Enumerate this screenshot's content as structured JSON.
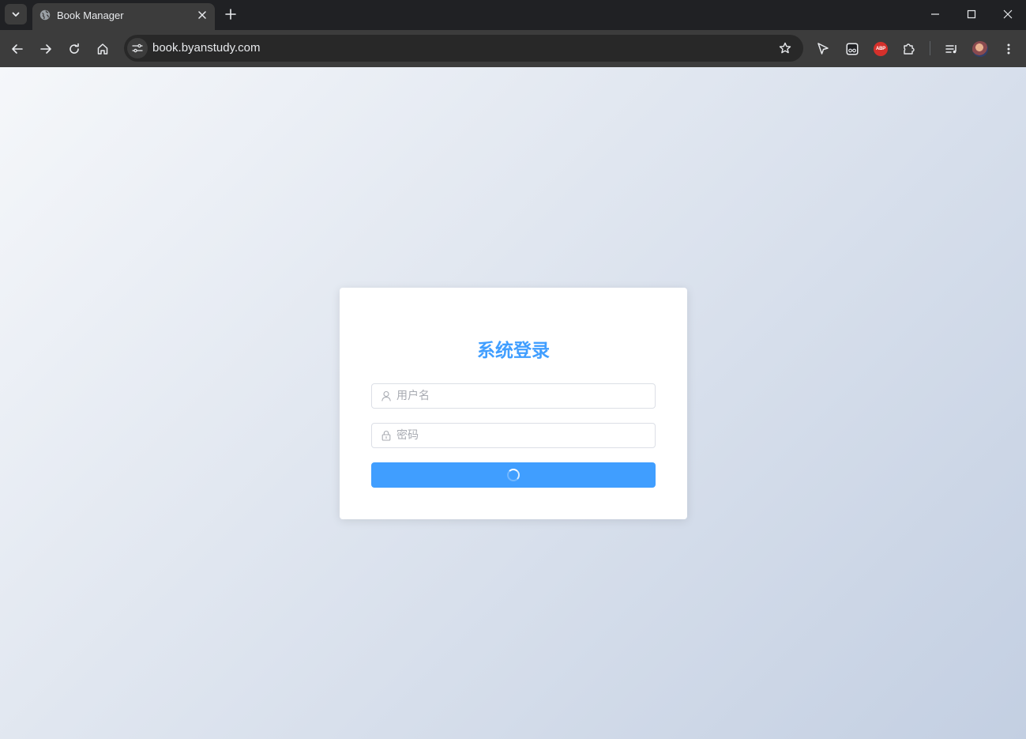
{
  "browser": {
    "tab": {
      "title": "Book Manager",
      "favicon": "globe-icon"
    },
    "address_bar": {
      "url": "book.byanstudy.com"
    },
    "extensions": [
      "cursor-icon",
      "reader-icon",
      "adblock-icon",
      "puzzle-icon",
      "media-queue-icon",
      "profile-avatar"
    ],
    "adblock_label": "ABP"
  },
  "login": {
    "title": "系统登录",
    "username": {
      "placeholder": "用户名",
      "value": "",
      "icon": "user-icon"
    },
    "password": {
      "placeholder": "密码",
      "value": "",
      "icon": "lock-icon"
    },
    "submit": {
      "state": "loading"
    }
  },
  "colors": {
    "accent": "#409eff",
    "page_gradient_start": "#f5f7fa",
    "page_gradient_end": "#c3cfe2"
  }
}
